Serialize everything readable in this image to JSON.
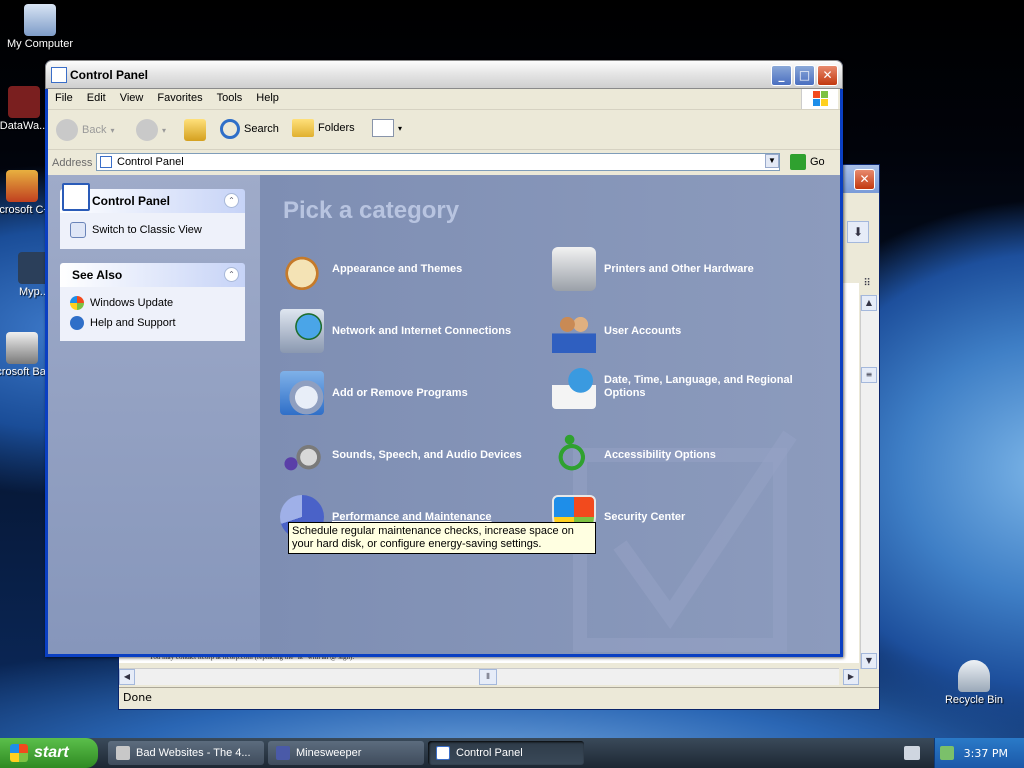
{
  "desktop": {
    "icons": [
      {
        "label": "My Computer"
      },
      {
        "label": "DataWa..."
      },
      {
        "label": "Microsoft C++"
      },
      {
        "label": "Myp..."
      },
      {
        "label": "Microsoft Basic"
      },
      {
        "label": "Recycle Bin"
      }
    ]
  },
  "back_window": {
    "status": "Done",
    "footer_text": "You may contact itcorp at itcorp.com (replacing the \"at\" with an @ sign)."
  },
  "window": {
    "title": "Control Panel",
    "menu": [
      "File",
      "Edit",
      "View",
      "Favorites",
      "Tools",
      "Help"
    ],
    "toolbar": {
      "back": "Back",
      "search": "Search",
      "folders": "Folders"
    },
    "address": {
      "label": "Address",
      "value": "Control Panel",
      "go": "Go"
    }
  },
  "left_pane": {
    "control_panel": {
      "title": "Control Panel",
      "link": "Switch to Classic View"
    },
    "see_also": {
      "title": "See Also",
      "links": [
        "Windows Update",
        "Help and Support"
      ]
    }
  },
  "main": {
    "heading": "Pick a category",
    "categories": [
      {
        "label": "Appearance and Themes",
        "icon": "appearance-icon"
      },
      {
        "label": "Printers and Other Hardware",
        "icon": "printer-icon"
      },
      {
        "label": "Network and Internet Connections",
        "icon": "network-icon"
      },
      {
        "label": "User Accounts",
        "icon": "users-icon"
      },
      {
        "label": "Add or Remove Programs",
        "icon": "programs-icon"
      },
      {
        "label": "Date, Time, Language, and Regional Options",
        "icon": "datetime-icon"
      },
      {
        "label": "Sounds, Speech, and Audio Devices",
        "icon": "sound-icon"
      },
      {
        "label": "Accessibility Options",
        "icon": "accessibility-icon"
      },
      {
        "label": "Performance and Maintenance",
        "icon": "performance-icon"
      },
      {
        "label": "Security Center",
        "icon": "shield-icon"
      }
    ],
    "tooltip": "Schedule regular maintenance checks, increase space on your hard disk, or configure energy-saving settings."
  },
  "taskbar": {
    "start": "start",
    "tasks": [
      "Bad Websites - The 4...",
      "Minesweeper",
      "Control Panel"
    ],
    "clock": "3:37 PM"
  }
}
